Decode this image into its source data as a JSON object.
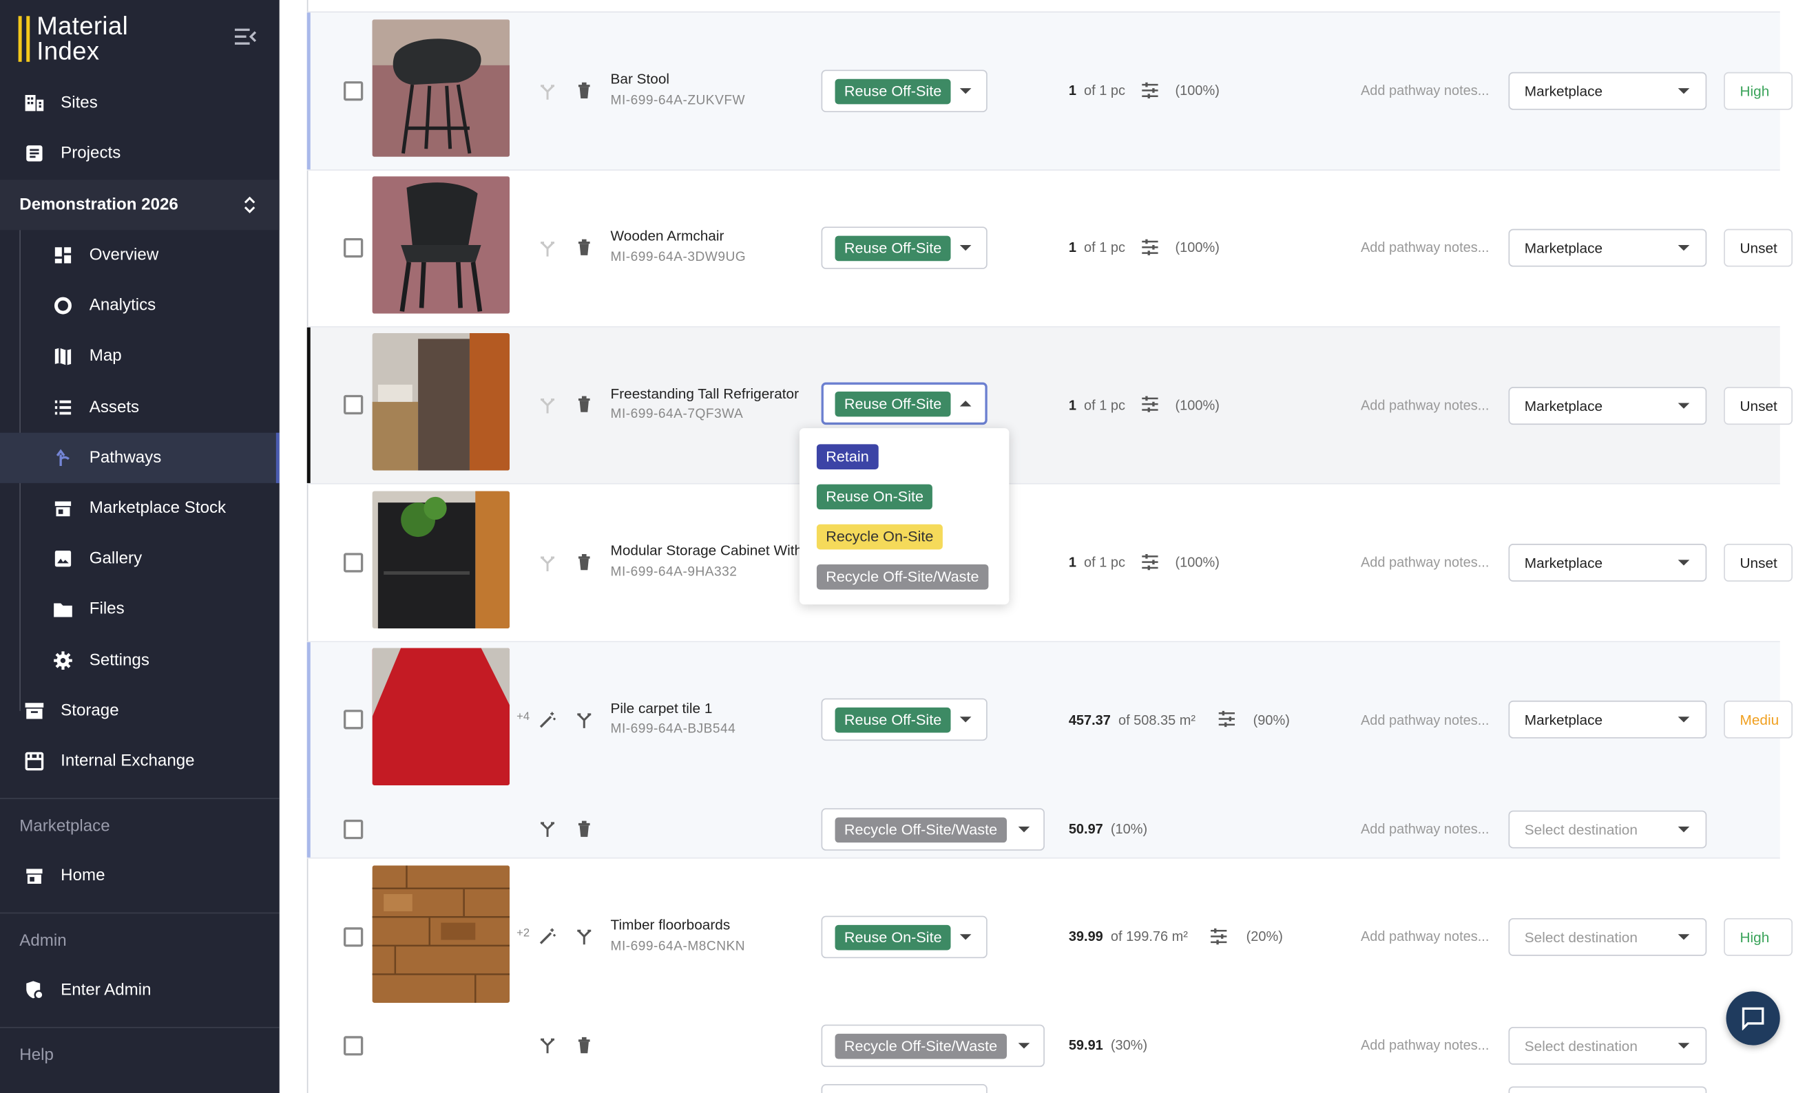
{
  "app": {
    "logo_line1": "Material",
    "logo_line2": "Index"
  },
  "sidebar": {
    "sites": "Sites",
    "projects": "Projects",
    "project_name": "Demonstration 2026",
    "sub": [
      "Overview",
      "Analytics",
      "Map",
      "Assets",
      "Pathways",
      "Marketplace Stock",
      "Gallery",
      "Files",
      "Settings"
    ],
    "storage": "Storage",
    "internal_exchange": "Internal Exchange",
    "marketplace_section": "Marketplace",
    "home": "Home",
    "admin_section": "Admin",
    "enter_admin": "Enter Admin",
    "help_section": "Help",
    "active_item": "Pathways"
  },
  "placeholders": {
    "notes": "Add pathway notes...",
    "destination": "Select destination"
  },
  "rows": [
    {
      "name": "Bar Stool",
      "code": "MI-699-64A-ZUKVFW",
      "pathway": "Reuse Off-Site",
      "qty": "1",
      "of": "of 1 pc",
      "pct": "(100%)",
      "dest": "Marketplace",
      "priority": "High"
    },
    {
      "name": "Wooden Armchair",
      "code": "MI-699-64A-3DW9UG",
      "pathway": "Reuse Off-Site",
      "qty": "1",
      "of": "of 1 pc",
      "pct": "(100%)",
      "dest": "Marketplace",
      "priority": "Unset"
    },
    {
      "name": "Freestanding Tall Refrigerator",
      "code": "MI-699-64A-7QF3WA",
      "pathway": "Reuse Off-Site",
      "qty": "1",
      "of": "of 1 pc",
      "pct": "(100%)",
      "dest": "Marketplace",
      "priority": "Unset"
    },
    {
      "name": "Modular Storage Cabinet With",
      "code": "MI-699-64A-9HA332",
      "pathway": "",
      "qty": "1",
      "of": "of 1 pc",
      "pct": "(100%)",
      "dest": "Marketplace",
      "priority": "Unset"
    },
    {
      "name": "Pile carpet tile 1",
      "code": "MI-699-64A-BJB544",
      "pathway": "Reuse Off-Site",
      "qty": "457.37",
      "of": "of 508.35 m²",
      "pct": "(90%)",
      "dest": "Marketplace",
      "priority": "Mediu",
      "plus": "+4"
    },
    {
      "pathway": "Recycle Off-Site/Waste",
      "qty": "50.97",
      "pct": "(10%)"
    },
    {
      "name": "Timber floorboards",
      "code": "MI-699-64A-M8CNKN",
      "pathway": "Reuse On-Site",
      "qty": "39.99",
      "of": "of 199.76 m²",
      "pct": "(20%)",
      "priority": "High",
      "plus": "+2"
    },
    {
      "pathway": "Recycle Off-Site/Waste",
      "qty": "59.91",
      "pct": "(30%)"
    }
  ],
  "menu_options": [
    "Retain",
    "Reuse On-Site",
    "Recycle On-Site",
    "Recycle Off-Site/Waste"
  ],
  "colors": {
    "sidebar": "#232634",
    "reuse": "#3d8a64",
    "recycle_waste": "#8f8f93",
    "retain": "#3c44a6",
    "recycle_onsite": "#f5da5a",
    "high": "#3aa35a",
    "medium": "#f0a020"
  }
}
